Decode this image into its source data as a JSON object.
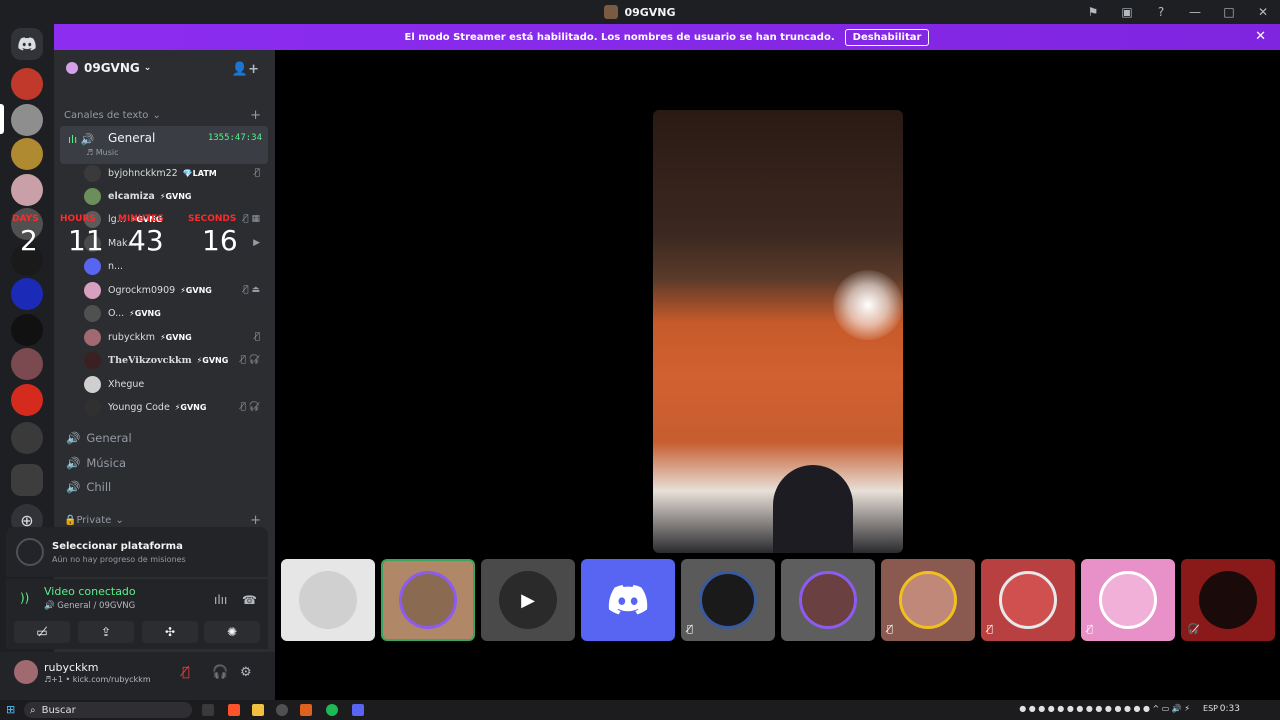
{
  "window": {
    "title": "09GVNG"
  },
  "banner": {
    "text": "El modo Streamer está habilitado. Los nombres de usuario se han truncado.",
    "button": "Deshabilitar"
  },
  "server": {
    "name": "09GVNG"
  },
  "categories": {
    "text": "Canales de texto",
    "private": "🔒Private"
  },
  "voice_channel": {
    "name": "General",
    "sub": "♬ Music",
    "timer": "1355:47:34"
  },
  "members": [
    {
      "name": "byjohnckkm22",
      "tag": "💎LATM",
      "icons": "🎙̸",
      "color": "#3a3a3a"
    },
    {
      "name": "elcamiza",
      "tag": "⚡GVNG",
      "icons": "",
      "color": "#6b8f5a"
    },
    {
      "name": "lg...",
      "tag": "⚡GVNG",
      "icons": "🎙̸ ▦",
      "color": "#5b5b5b"
    },
    {
      "name": "Mak...",
      "tag": "",
      "icons": "▶",
      "color": "#4b4b4b"
    },
    {
      "name": "n...",
      "tag": "",
      "icons": "",
      "color": "#5865f2"
    },
    {
      "name": "Ogrockm0909",
      "tag": "⚡GVNG",
      "icons": "🎙̸ ⏏",
      "color": "#d8a0c0"
    },
    {
      "name": "O...",
      "tag": "⚡GVNG",
      "icons": "",
      "color": "#505050"
    },
    {
      "name": "rubyckkm",
      "tag": "⚡GVNG",
      "icons": "🎙̸",
      "color": "#a06a70"
    },
    {
      "name": "TheVikzovckkm",
      "tag": "⚡GVNG",
      "icons": "🎙̸ 🎧̸",
      "color": "#3a2020"
    },
    {
      "name": "Xhegue",
      "tag": "",
      "icons": "",
      "color": "#cfcfcf"
    },
    {
      "name": "Youngg Code",
      "tag": "⚡GVNG",
      "icons": "🎙̸ 🎧̸",
      "color": "#303030"
    }
  ],
  "channels": [
    {
      "name": "General",
      "icon": "🔊"
    },
    {
      "name": "Música",
      "icon": "🎶"
    },
    {
      "name": "Chill",
      "icon": "🎤"
    }
  ],
  "countdown": {
    "labels": [
      "DAYS",
      "HOURS",
      "MINUTES",
      "SECONDS"
    ],
    "values": [
      "2",
      "11",
      "43",
      "16"
    ]
  },
  "quest": {
    "title": "Seleccionar plataforma",
    "sub": "Aún no hay progreso de misiones"
  },
  "voice": {
    "status": "Video conectado",
    "sub": "🔊 General / 09GVNG"
  },
  "user": {
    "name": "rubyckkm",
    "sub": "♬+1 • kick.com/rubyckkm"
  },
  "taskbar": {
    "search": "Buscar",
    "lang": "ESP",
    "time": "0:33"
  }
}
